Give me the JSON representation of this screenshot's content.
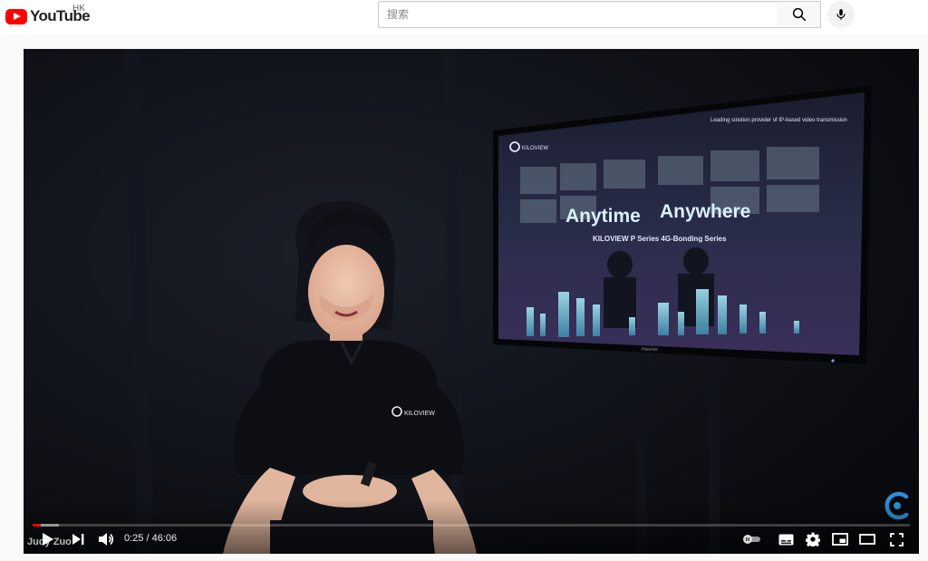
{
  "masthead": {
    "logo_text": "YouTube",
    "region": "HK",
    "search_placeholder": "搜索",
    "icons": [
      "youtube-logo",
      "search-icon",
      "microphone-icon"
    ]
  },
  "video": {
    "screen_tagline": "Leading solution provider of IP-based video transmission",
    "screen_headline_left": "Anytime",
    "screen_headline_right": "Anywhere",
    "screen_subtitle": "KILOVIEW P Series 4G-Bonding Series",
    "screen_logo": "KILOVIEW",
    "tv_brand": "Hisense",
    "shirt_logo": "KILOVIEW",
    "uploader_overlay": "Judy Zuo",
    "watermark_icon": "kiloview-c-icon"
  },
  "player": {
    "current_time": "0:25",
    "duration": "46:06",
    "time_display": "0:25 / 46:06",
    "played_fraction": 0.009,
    "loaded_fraction": 0.03,
    "accent_color": "#ff0000",
    "icons": [
      "play-icon",
      "next-icon",
      "volume-icon",
      "autoplay-toggle-icon",
      "subtitles-icon",
      "settings-icon",
      "miniplayer-icon",
      "theater-icon",
      "fullscreen-icon"
    ]
  }
}
